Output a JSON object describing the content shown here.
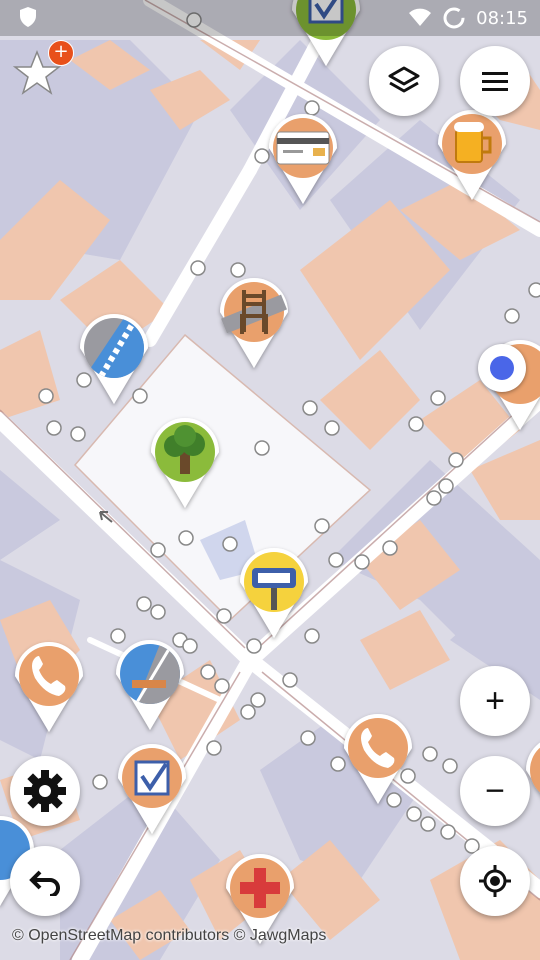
{
  "status_bar": {
    "time": "08:15",
    "icons": [
      "shield-icon",
      "moon-icon",
      "wifi-icon",
      "sync-ring-icon"
    ]
  },
  "map": {
    "attribution": "© OpenStreetMap contributors © JawgMaps",
    "colors": {
      "land": "#dcdbe6",
      "buildings": "#f0c7b0",
      "blocks": "#c8c8dc",
      "roads": "#ffffff",
      "plaza": "#f7f7f9",
      "pin_orange": "#e9a06c",
      "pin_green": "#8bbb3a",
      "pin_yellow": "#f5d23c",
      "pin_blue": "#4a8fd8",
      "location_blue": "#4a66e8"
    },
    "markers": [
      {
        "name": "checklist-pin-top",
        "icon": "checkbox-icon",
        "color": "green"
      },
      {
        "name": "atm-card-pin",
        "icon": "credit-card-icon",
        "color": "orange"
      },
      {
        "name": "beer-pin",
        "icon": "beer-mug-icon",
        "color": "orange"
      },
      {
        "name": "bench-pin",
        "icon": "chair-icon",
        "color": "orange"
      },
      {
        "name": "crossing-pin",
        "icon": "crosswalk-icon",
        "color": "blue"
      },
      {
        "name": "tree-pin",
        "icon": "tree-icon",
        "color": "green"
      },
      {
        "name": "bus-stop-pin",
        "icon": "bus-sign-icon",
        "color": "yellow"
      },
      {
        "name": "phone-pin-left",
        "icon": "phone-icon",
        "color": "orange"
      },
      {
        "name": "kerb-pin",
        "icon": "kerb-icon",
        "color": "blue"
      },
      {
        "name": "checklist-pin-bottom",
        "icon": "checkbox-icon",
        "color": "orange"
      },
      {
        "name": "phone-pin-right",
        "icon": "phone-icon",
        "color": "orange"
      },
      {
        "name": "pharmacy-pin",
        "icon": "red-cross-icon",
        "color": "orange"
      }
    ]
  },
  "controls": {
    "star_badge": "+",
    "layers": "layers-icon",
    "menu": "hamburger-menu-icon",
    "zoom_in": "+",
    "zoom_out": "−",
    "settings": "gear-icon",
    "undo": "undo-icon",
    "locate": "my-location-icon"
  }
}
